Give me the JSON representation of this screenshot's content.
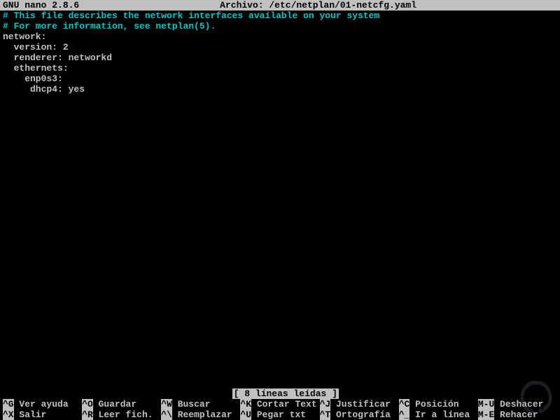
{
  "title": {
    "app": "GNU nano 2.8.6",
    "file_label": "Archivo: /etc/netplan/01-netcfg.yaml"
  },
  "file_lines": [
    {
      "cls": "comment",
      "text": "# This file describes the network interfaces available on your system"
    },
    {
      "cls": "comment",
      "text": "# For more information, see netplan(5)."
    },
    {
      "cls": "plain",
      "text": "network:"
    },
    {
      "cls": "plain",
      "text": "  version: 2"
    },
    {
      "cls": "plain",
      "text": "  renderer: networkd"
    },
    {
      "cls": "plain",
      "text": "  ethernets:"
    },
    {
      "cls": "plain",
      "text": "    enp0s3:"
    },
    {
      "cls": "plain",
      "text": "     dhcp4: yes"
    }
  ],
  "status": "[ 8 líneas leídas ]",
  "help": {
    "row1": [
      {
        "key": "^G",
        "label": " Ver ayuda"
      },
      {
        "key": "^O",
        "label": " Guardar"
      },
      {
        "key": "^W",
        "label": " Buscar"
      },
      {
        "key": "^K",
        "label": " Cortar Text"
      },
      {
        "key": "^J",
        "label": " Justificar"
      },
      {
        "key": "^C",
        "label": " Posición"
      },
      {
        "key": "M-U",
        "label": " Deshacer"
      }
    ],
    "row2": [
      {
        "key": "^X",
        "label": " Salir"
      },
      {
        "key": "^R",
        "label": " Leer fich."
      },
      {
        "key": "^\\",
        "label": " Reemplazar"
      },
      {
        "key": "^U",
        "label": " Pegar txt"
      },
      {
        "key": "^T",
        "label": " Ortografía"
      },
      {
        "key": "^_",
        "label": " Ir a línea"
      },
      {
        "key": "M-E",
        "label": " Rehacer"
      }
    ]
  }
}
